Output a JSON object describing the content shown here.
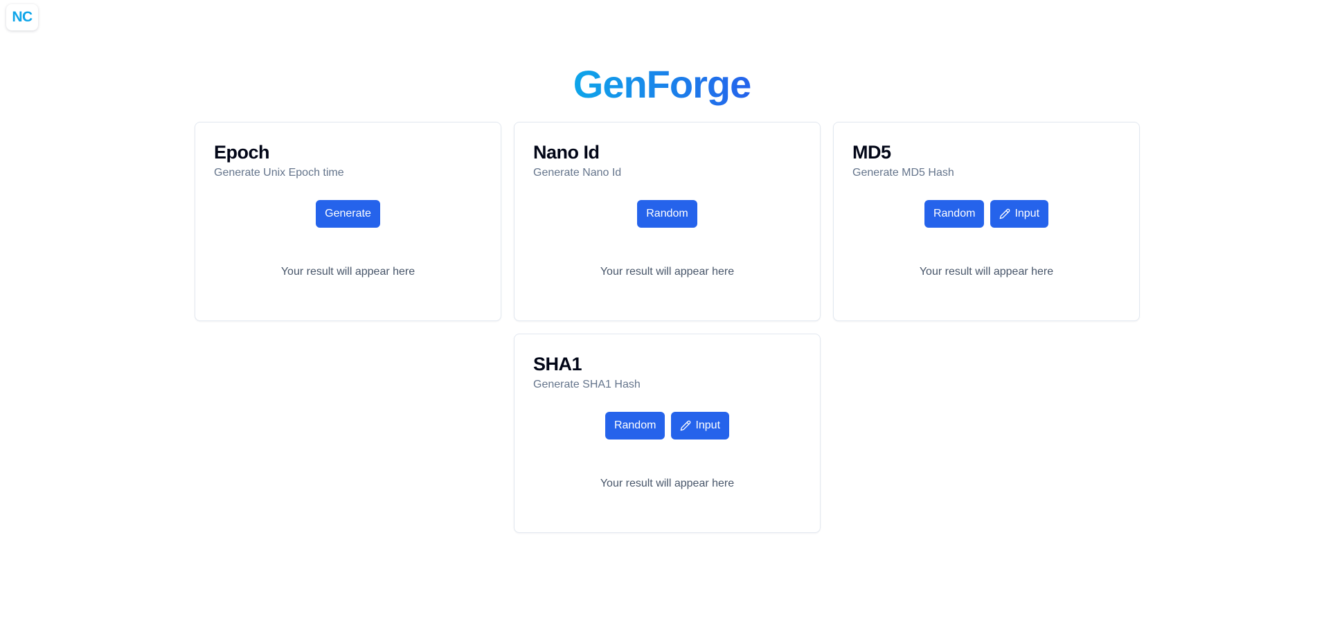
{
  "app": {
    "logo_text": "NC",
    "title": "GenForge"
  },
  "colors": {
    "brand_gradient_start": "#0ea5e9",
    "brand_gradient_end": "#2563eb",
    "button_bg": "#2563eb",
    "card_border": "#e2e8f0",
    "muted_text": "#64748b"
  },
  "cards": [
    {
      "title": "Epoch",
      "description": "Generate Unix Epoch time",
      "buttons": [
        {
          "label": "Generate",
          "icon": ""
        }
      ],
      "result_placeholder": "Your result will appear here"
    },
    {
      "title": "Nano Id",
      "description": "Generate Nano Id",
      "buttons": [
        {
          "label": "Random",
          "icon": ""
        }
      ],
      "result_placeholder": "Your result will appear here"
    },
    {
      "title": "MD5",
      "description": "Generate MD5 Hash",
      "buttons": [
        {
          "label": "Random",
          "icon": ""
        },
        {
          "label": "Input",
          "icon": "pencil-icon"
        }
      ],
      "result_placeholder": "Your result will appear here"
    },
    {
      "title": "SHA1",
      "description": "Generate SHA1 Hash",
      "buttons": [
        {
          "label": "Random",
          "icon": ""
        },
        {
          "label": "Input",
          "icon": "pencil-icon"
        }
      ],
      "result_placeholder": "Your result will appear here"
    }
  ]
}
